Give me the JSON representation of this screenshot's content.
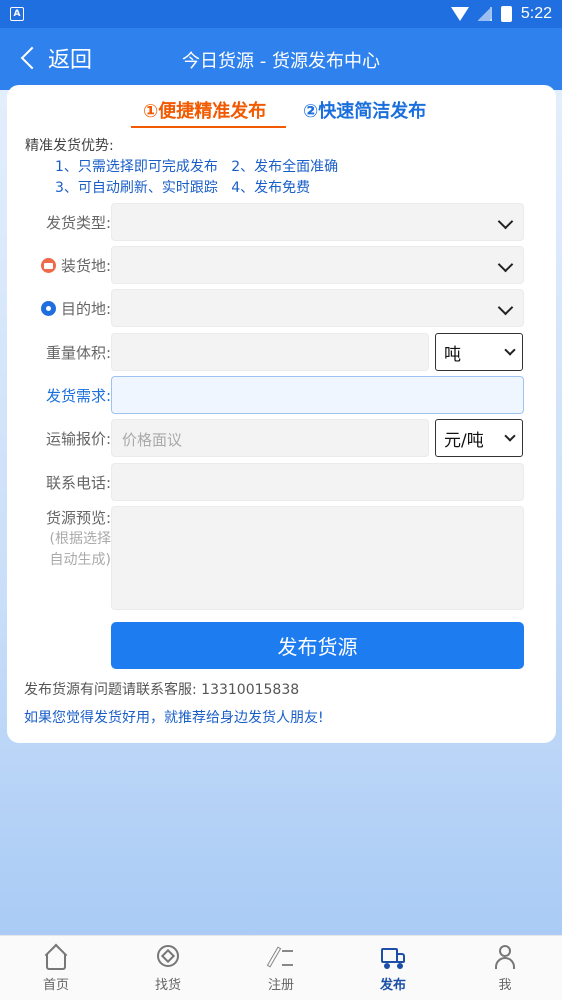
{
  "status_bar": {
    "time": "5:22",
    "left_icon": "A"
  },
  "header": {
    "back_label": "返回",
    "title": "今日货源 - 货源发布中心"
  },
  "tabs": [
    {
      "label": "①便捷精准发布",
      "active": true
    },
    {
      "label": "②快速简洁发布",
      "active": false
    }
  ],
  "advantages": {
    "title": "精准发货优势:",
    "line1": "1、只需选择即可完成发布   2、发布全面准确",
    "line2": "3、可自动刷新、实时跟踪   4、发布免费"
  },
  "form": {
    "cargo_type_label": "发货类型:",
    "load_place_label": "装货地:",
    "destination_label": "目的地:",
    "weight_label": "重量体积:",
    "weight_unit": "吨",
    "demand_label": "发货需求:",
    "price_label": "运输报价:",
    "price_placeholder": "价格面议",
    "price_unit": "元/吨",
    "phone_label": "联系电话:",
    "preview_label": "货源预览:",
    "preview_hint_1": "(根据选择",
    "preview_hint_2": "自动生成)"
  },
  "submit_label": "发布货源",
  "contact_text": "发布货源有问题请联系客服: 13310015838",
  "recommend_text": "如果您觉得发货好用，就推荐给身边发货人朋友!",
  "bottom_nav": [
    {
      "label": "首页",
      "icon": "home-icon",
      "active": false
    },
    {
      "label": "找货",
      "icon": "find-cargo-icon",
      "active": false
    },
    {
      "label": "注册",
      "icon": "register-icon",
      "active": false
    },
    {
      "label": "发布",
      "icon": "publish-truck-icon",
      "active": true
    },
    {
      "label": "我",
      "icon": "user-icon",
      "active": false
    }
  ],
  "colors": {
    "primary": "#2f82ee",
    "active_tab": "#f15a00",
    "button": "#1d7cf0"
  }
}
